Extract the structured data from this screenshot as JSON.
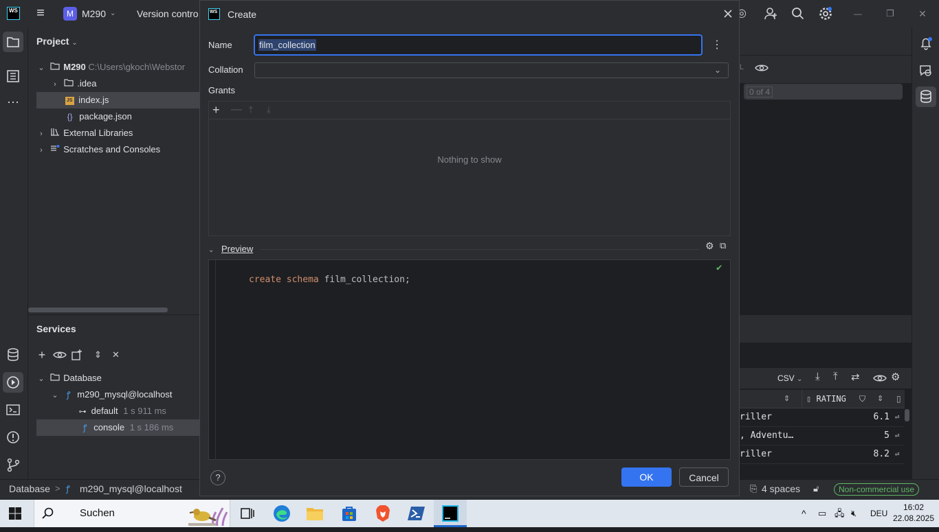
{
  "titlebar": {
    "menu_glyph": "≡",
    "project_badge": "M",
    "project_name": "M290",
    "vcs_label": "Version contro",
    "minimize": "—",
    "restore": "❐",
    "close": "✕"
  },
  "project_panel": {
    "title": "Project",
    "tree": [
      {
        "label": "M290",
        "hint": "C:\\Users\\gkoch\\Webstor"
      },
      {
        "label": ".idea"
      },
      {
        "label": "index.js"
      },
      {
        "label": "package.json"
      },
      {
        "label": "External Libraries"
      },
      {
        "label": "Scratches and Consoles"
      }
    ]
  },
  "services_panel": {
    "title": "Services",
    "tree": [
      {
        "label": "Database"
      },
      {
        "label": "m290_mysql@localhost"
      },
      {
        "label": "default",
        "hint": "1 s 911 ms"
      },
      {
        "label": "console",
        "hint": "1 s 186 ms"
      }
    ]
  },
  "dialog": {
    "title": "Create",
    "name_label": "Name",
    "name_value": "film_collection",
    "collation_label": "Collation",
    "collation_value": "",
    "grants_label": "Grants",
    "grants_empty": "Nothing to show",
    "preview_label": "Preview",
    "preview_code": {
      "kw1": "create",
      "kw2": "schema",
      "ident": "film_collection;"
    },
    "help": "?",
    "ok": "OK",
    "cancel": "Cancel"
  },
  "right_area": {
    "counter": "0 of 4",
    "format": "CSV",
    "column_header": "RATING",
    "rows": [
      {
        "genre": "riller",
        "rating": "6.1"
      },
      {
        "genre": ", Adventu…",
        "rating": "5"
      },
      {
        "genre": "riller",
        "rating": "8.2"
      }
    ]
  },
  "statusbar": {
    "breadcrumb_root": "Database",
    "breadcrumb_sep": ">",
    "breadcrumb_leaf": "m290_mysql@localhost",
    "indent": "4 spaces",
    "license": "Non-commercial use"
  },
  "taskbar": {
    "search": "Suchen",
    "language": "DEU",
    "time": "16:02",
    "date": "22.08.2025"
  },
  "colors": {
    "accent": "#3574f0",
    "license_green": "#5fb865",
    "keyword": "#cf8e6d"
  }
}
